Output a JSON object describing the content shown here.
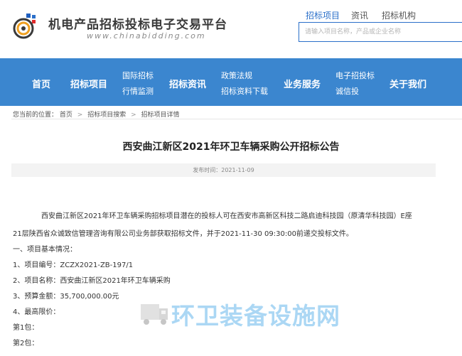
{
  "header": {
    "site_title": "机电产品招标投标电子交易平台",
    "site_url": "www.chinabidding.com"
  },
  "search": {
    "tabs": [
      {
        "label": "招标项目"
      },
      {
        "label": "资讯"
      },
      {
        "label": "招标机构"
      }
    ],
    "placeholder": "请输入项目名称，产品或企业名称"
  },
  "nav": {
    "items": [
      {
        "label": "首页"
      },
      {
        "label": "招标项目"
      },
      {
        "line1": "国际招标",
        "line2": "行情监测"
      },
      {
        "label": "招标资讯"
      },
      {
        "line1": "政策法规",
        "line2": "招标资料下载"
      },
      {
        "label": "业务服务"
      },
      {
        "line1": "电子招投标",
        "line2": "诚信投"
      },
      {
        "label": "关于我们"
      }
    ]
  },
  "breadcrumb": {
    "prefix": "您当前的位置：",
    "items": [
      "首页",
      "招标项目搜索",
      "招标项目详情"
    ],
    "separator": ">"
  },
  "article": {
    "title": "西安曲江新区2021年环卫车辆采购公开招标公告",
    "publish_time": "发布时间：2021-11-09",
    "paragraph_line1": "西安曲江新区2021年环卫车辆采购招标项目潜在的投标人可在西安市高新区科技二路启迪科技园（原清华科技园）E座",
    "paragraph_line2": "21层陕西省众诚致信管理咨询有限公司业务部获取招标文件，并于2021-11-30 09:30:00前递交投标文件。",
    "section1": "一、项目基本情况：",
    "item1": "1、项目编号：ZCZX2021-ZB-197/1",
    "item2": "2、项目名称：西安曲江新区2021年环卫车辆采购",
    "item3": "3、预算金额：35,700,000.00元",
    "item4": "4、最高限价：",
    "pkg1": "第1包：",
    "pkg2": "第2包："
  },
  "watermark": {
    "text": "环卫装备设施网"
  },
  "colors": {
    "nav_bg": "#3b86cf",
    "accent": "#2a6fc9",
    "watermark": "#9dd1f3"
  }
}
